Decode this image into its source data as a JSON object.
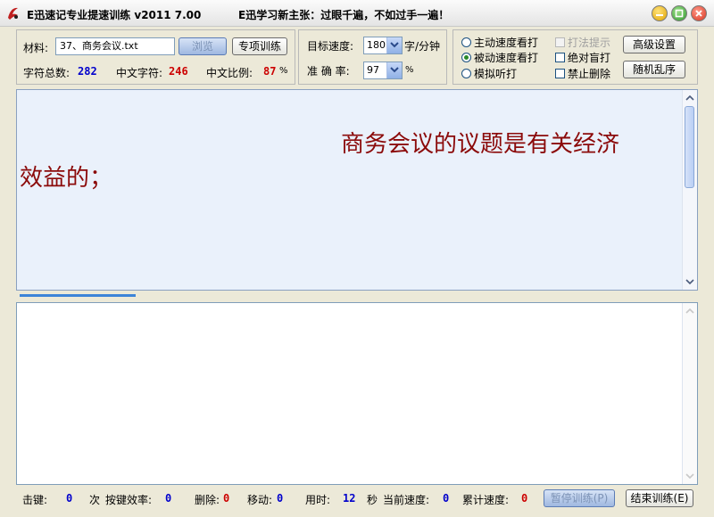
{
  "window": {
    "title": "E迅速记专业提速训练 v2011  7.00",
    "slogan": "E迅学习新主张：过眼千遍，不如过手一遍！"
  },
  "material": {
    "label": "材料:",
    "file": "37、商务会议.txt",
    "browse_label": "浏览",
    "special_label": "专项训练"
  },
  "stats": {
    "total_label": "字符总数:",
    "total": "282",
    "cn_label": "中文字符:",
    "cn": "246",
    "ratio_label": "中文比例:",
    "ratio": "87",
    "ratio_unit": "%"
  },
  "target": {
    "speed_label": "目标速度:",
    "speed": "180",
    "speed_unit": "字/分钟",
    "accuracy_label": "准 确 率:",
    "accuracy": "97",
    "accuracy_unit": "%"
  },
  "modes": {
    "active": "主动速度看打",
    "passive": "被动速度看打",
    "listen": "模拟听打",
    "selected": "passive"
  },
  "options": {
    "hint": "打法提示",
    "blind": "绝对盲打",
    "nodelete": "禁止删除",
    "advanced": "高级设置",
    "shuffle": "随机乱序"
  },
  "text": {
    "line1": "商务会议的议题是有关经济",
    "line2": "效益的；"
  },
  "progress": 0.175,
  "status": {
    "keys_label": "击键:",
    "keys": "0",
    "keys_unit": "次",
    "eff_label": "按键效率:",
    "eff": "0",
    "del_label": "删除:",
    "del": "0",
    "move_label": "移动:",
    "move": "0",
    "time_label": "用时:",
    "time": "12",
    "time_unit": "秒",
    "cur_label": "当前速度:",
    "cur": "0",
    "cum_label": "累计速度:",
    "cum": "0",
    "pause_label": "暂停训练(P)",
    "end_label": "结束训练(E)"
  }
}
